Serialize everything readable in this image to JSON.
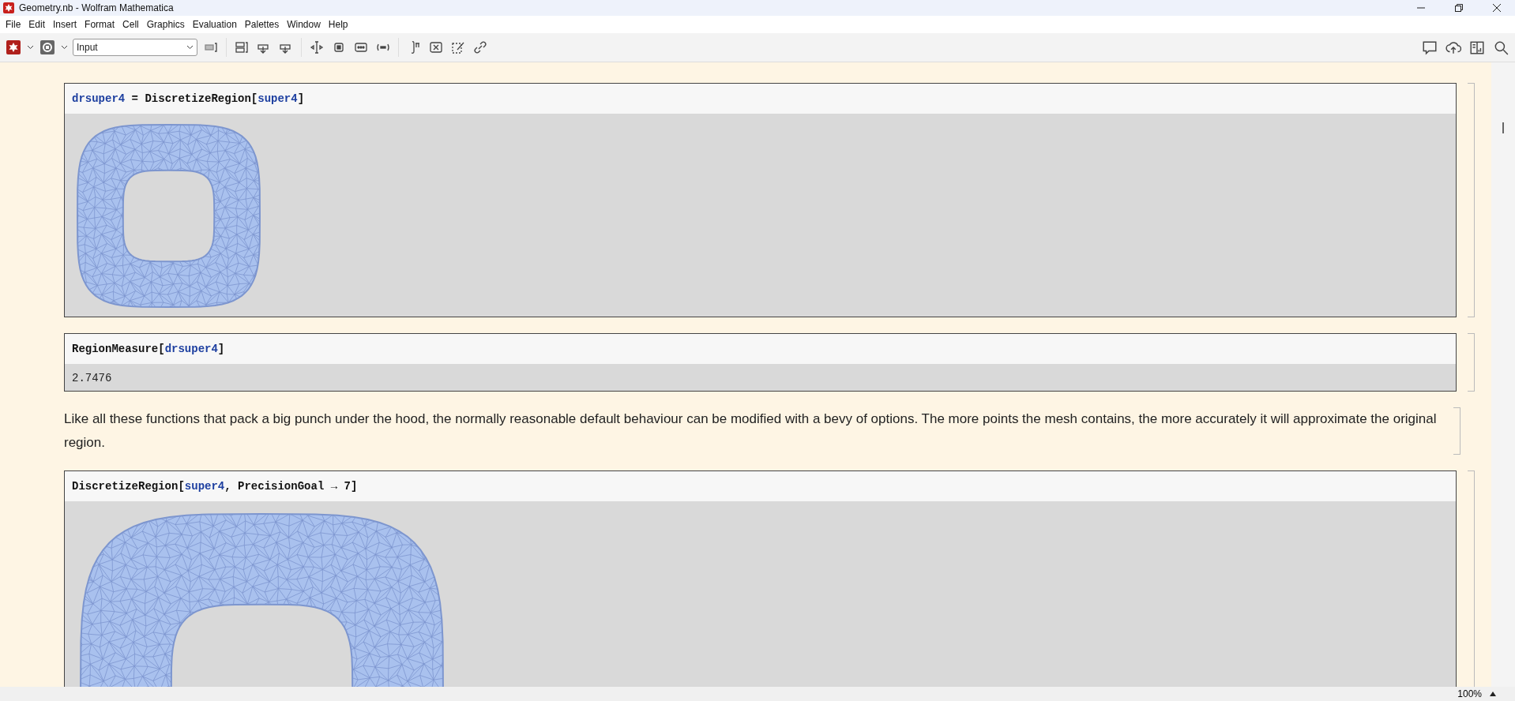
{
  "window": {
    "title": "Geometry.nb - Wolfram Mathematica"
  },
  "menu": [
    "File",
    "Edit",
    "Insert",
    "Format",
    "Cell",
    "Graphics",
    "Evaluation",
    "Palettes",
    "Window",
    "Help"
  ],
  "toolbar": {
    "style_select": "Input"
  },
  "cells": [
    {
      "kind": "io",
      "input": [
        {
          "kind": "user",
          "text": "drsuper4"
        },
        {
          "kind": "plain",
          "text": " = "
        },
        {
          "kind": "builtin",
          "text": "DiscretizeRegion"
        },
        {
          "kind": "plain",
          "text": "["
        },
        {
          "kind": "user",
          "text": "super4"
        },
        {
          "kind": "plain",
          "text": "]"
        }
      ],
      "output": {
        "kind": "mesh"
      }
    },
    {
      "kind": "io",
      "input": [
        {
          "kind": "builtin",
          "text": "RegionMeasure"
        },
        {
          "kind": "plain",
          "text": "["
        },
        {
          "kind": "user",
          "text": "drsuper4"
        },
        {
          "kind": "plain",
          "text": "]"
        }
      ],
      "output": {
        "kind": "text",
        "text": "2.7476"
      }
    },
    {
      "kind": "text",
      "text": "Like all these functions that pack a big punch under the hood, the normally reasonable default behaviour can be modified with a bevy of options. The more points the mesh contains, the more accurately it will approximate the original region."
    },
    {
      "kind": "io",
      "input": [
        {
          "kind": "builtin",
          "text": "DiscretizeRegion"
        },
        {
          "kind": "plain",
          "text": "["
        },
        {
          "kind": "user",
          "text": "super4"
        },
        {
          "kind": "plain",
          "text": ", "
        },
        {
          "kind": "builtin",
          "text": "PrecisionGoal"
        },
        {
          "kind": "plain",
          "text": " → "
        },
        {
          "kind": "builtin",
          "text": "7"
        },
        {
          "kind": "plain",
          "text": "]"
        }
      ],
      "output": {
        "kind": "mesh_fine"
      }
    }
  ],
  "status_bar": {
    "zoom": "100%"
  }
}
